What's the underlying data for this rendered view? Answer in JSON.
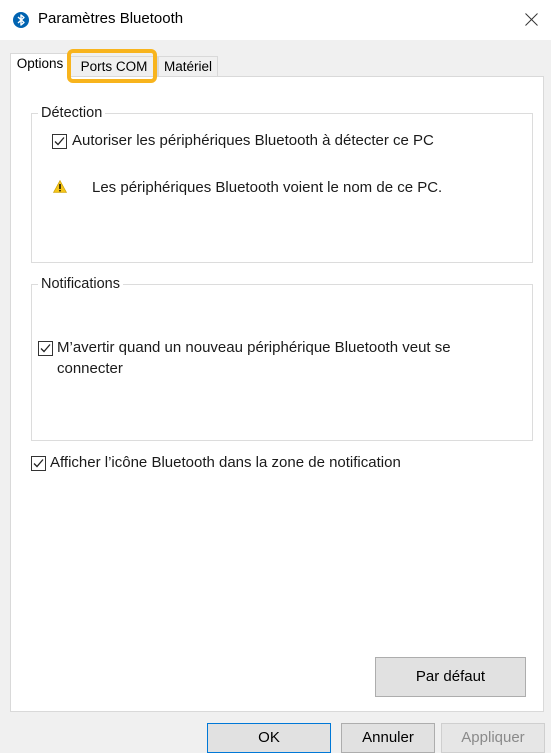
{
  "window": {
    "title": "Paramètres Bluetooth"
  },
  "tabs": [
    {
      "label": "Options",
      "active": true
    },
    {
      "label": "Ports COM",
      "active": false
    },
    {
      "label": "Matériel",
      "active": false
    }
  ],
  "detection": {
    "title": "Détection",
    "allow_discovery": {
      "label": "Autoriser les périphériques Bluetooth à détecter ce PC",
      "checked": true
    },
    "warning_text": "Les périphériques Bluetooth voient le nom de ce PC."
  },
  "notifications": {
    "title": "Notifications",
    "alert_new_device": {
      "label_line1": "M’avertir quand un nouveau périphérique Bluetooth veut se",
      "label_line2": "connecter",
      "checked": true
    }
  },
  "show_icon": {
    "label": "Afficher l’icône Bluetooth dans la zone de notification",
    "checked": true
  },
  "buttons": {
    "restore_defaults": "Par défaut",
    "ok": "OK",
    "cancel": "Annuler",
    "apply": "Appliquer"
  },
  "colors": {
    "highlight": "#f8b41d",
    "bluetooth": "#0063b1",
    "warning": "#f5c518"
  }
}
